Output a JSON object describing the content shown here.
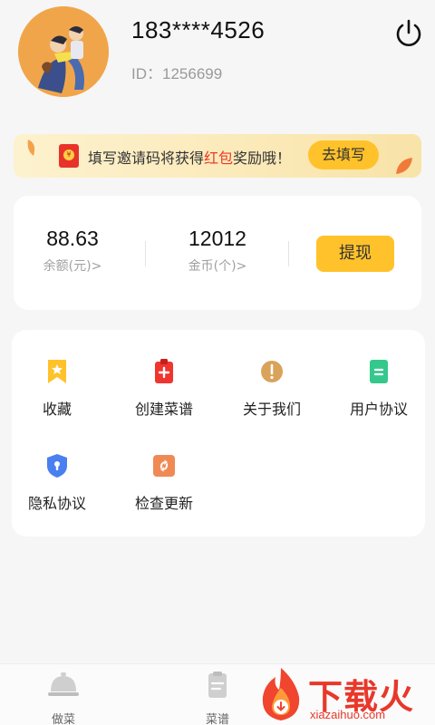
{
  "profile": {
    "phone": "183****4526",
    "user_id": "ID：1256699"
  },
  "banner": {
    "text_before": "填写邀请码将获得",
    "text_highlight": "红包",
    "text_after": "奖励哦！",
    "button_label": "去填写"
  },
  "wallet": {
    "balance_value": "88.63",
    "balance_label": "余额(元)>",
    "coins_value": "12012",
    "coins_label": "金币(个)>",
    "withdraw_label": "提现"
  },
  "menu": {
    "items": [
      {
        "label": "收藏",
        "icon": "bookmark-star-icon",
        "color": "#ffc22a"
      },
      {
        "label": "创建菜谱",
        "icon": "clipboard-plus-icon",
        "color": "#f0352f"
      },
      {
        "label": "关于我们",
        "icon": "info-exclamation-icon",
        "color": "#d9a35a"
      },
      {
        "label": "用户协议",
        "icon": "document-equals-icon",
        "color": "#35c88d"
      },
      {
        "label": "隐私协议",
        "icon": "shield-lock-icon",
        "color": "#4a7ff0"
      },
      {
        "label": "检查更新",
        "icon": "refresh-lightning-icon",
        "color": "#f08a55"
      }
    ]
  },
  "bottom_nav": {
    "items": [
      {
        "label": "做菜",
        "icon": "cloche-icon"
      },
      {
        "label": "菜谱",
        "icon": "recipe-book-icon"
      }
    ]
  },
  "watermark": {
    "title": "下载火",
    "domain": "xiazaihuo.com"
  },
  "colors": {
    "accent": "#ffc22a",
    "highlight_red": "#e83b2a",
    "background": "#f6f6f6"
  }
}
